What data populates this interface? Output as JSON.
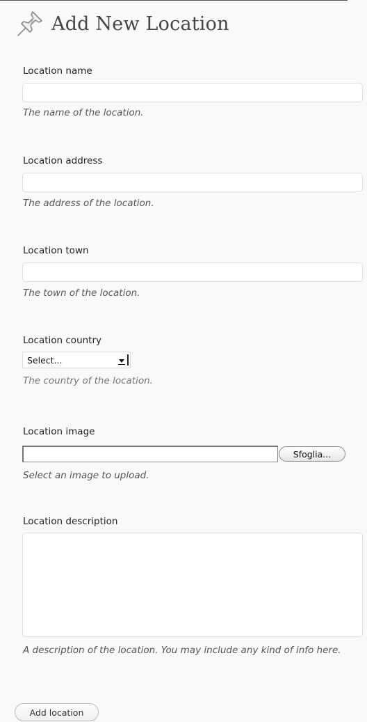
{
  "page": {
    "title": "Add New Location",
    "icon": "pushpin-icon"
  },
  "fields": {
    "name": {
      "label": "Location name",
      "value": "",
      "hint": "The name of the location."
    },
    "address": {
      "label": "Location address",
      "value": "",
      "hint": "The address of the location."
    },
    "town": {
      "label": "Location town",
      "value": "",
      "hint": "The town of the location."
    },
    "country": {
      "label": "Location country",
      "selected": "Select...",
      "hint": "The country of the location."
    },
    "image": {
      "label": "Location image",
      "browse_label": "Sfoglia...",
      "hint": "Select an image to upload."
    },
    "description": {
      "label": "Location description",
      "value": "",
      "hint": "A description of the location. You may include any kind of info here."
    }
  },
  "actions": {
    "submit_label": "Add location"
  }
}
